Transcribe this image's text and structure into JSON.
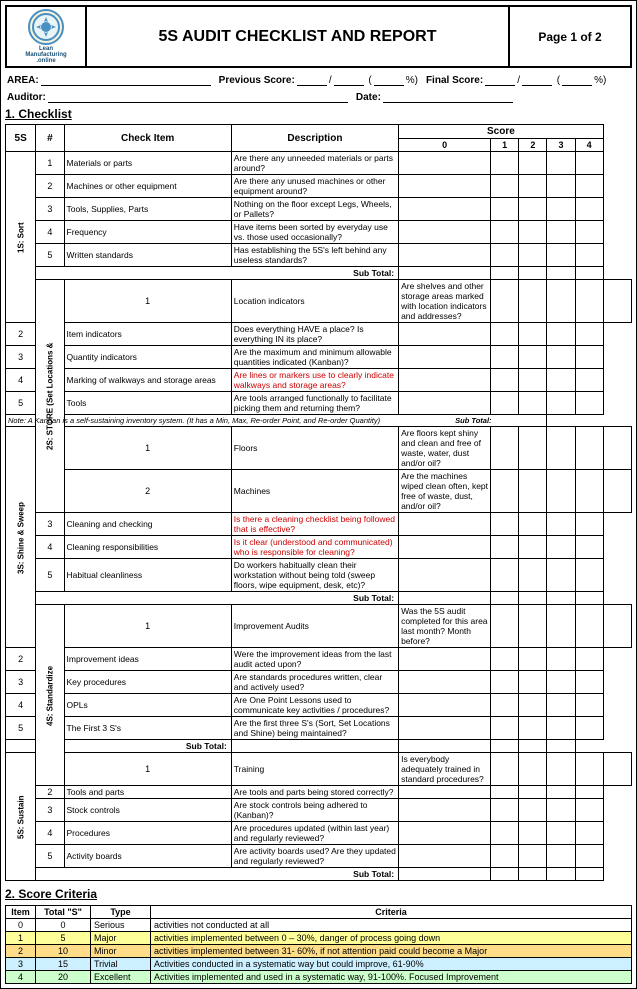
{
  "header": {
    "logo_line1": "Lean",
    "logo_line2": "Manufacturing",
    "logo_line3": ".online",
    "title": "5S AUDIT CHECKLIST AND REPORT",
    "page": "Page 1 of 2"
  },
  "form": {
    "area_label": "AREA:",
    "previous_score_label": "Previous Score:",
    "percent_label": "%",
    "final_score_label": "Final Score:",
    "auditor_label": "Auditor:",
    "date_label": "Date:"
  },
  "section1": {
    "title": "1. Checklist",
    "col_5s": "5S",
    "col_num": "#",
    "col_check": "Check Item",
    "col_desc": "Description",
    "col_score": "Score",
    "score_cols": [
      "0",
      "1",
      "2",
      "3",
      "4"
    ],
    "categories": [
      {
        "name": "1S: Sort",
        "items": [
          {
            "num": "1",
            "check": "Materials or parts",
            "desc": "Are there any unneeded materials or parts around?"
          },
          {
            "num": "2",
            "check": "Machines or other equipment",
            "desc": "Are there any unused machines or other equipment around?"
          },
          {
            "num": "3",
            "check": "Tools, Supplies, Parts",
            "desc": "Nothing on the floor except Legs, Wheels, or Pallets?"
          },
          {
            "num": "4",
            "check": "Frequency",
            "desc": "Have items been sorted by everyday use vs. those used occasionally?"
          },
          {
            "num": "5",
            "check": "Written standards",
            "desc": "Has establishing the 5S's left behind any useless standards?"
          }
        ],
        "subtotal": "Sub Total:"
      },
      {
        "name": "2S: STORE (Set Locations &",
        "items": [
          {
            "num": "1",
            "check": "Location indicators",
            "desc": "Are shelves and other storage areas marked with location indicators and addresses?"
          },
          {
            "num": "2",
            "check": "Item indicators",
            "desc": "Does everything HAVE a place?  Is everything IN its place?"
          },
          {
            "num": "3",
            "check": "Quantity indicators",
            "desc": "Are the maximum and minimum allowable quantities indicated (Kanban)?"
          },
          {
            "num": "4",
            "check": "Marking of walkways and storage areas",
            "desc": "Are lines or markers use to clearly indicate walkways and storage areas?",
            "red": true
          },
          {
            "num": "5",
            "check": "Tools",
            "desc": "Are tools arranged functionally to facilitate picking them and returning them?"
          }
        ],
        "note": "Note: A Kanban is a self-sustaining inventory system. (It has a Min, Max, Re-order Point, and Re-order Quantity)",
        "subtotal": "Sub Total:"
      },
      {
        "name": "3S: Shine & Sweep",
        "items": [
          {
            "num": "1",
            "check": "Floors",
            "desc": "Are floors kept shiny and clean and free of waste, water, dust and/or oil?"
          },
          {
            "num": "2",
            "check": "Machines",
            "desc": "Are the machines wiped clean often, kept free of waste, dust, and/or oil?"
          },
          {
            "num": "3",
            "check": "Cleaning and checking",
            "desc": "Is there a cleaning checklist being followed that is effective?",
            "red": true
          },
          {
            "num": "4",
            "check": "Cleaning responsibilities",
            "desc": "Is it clear (understood and communicated) who is responsible for cleaning?",
            "red": true
          },
          {
            "num": "5",
            "check": "Habitual cleanliness",
            "desc": "Do workers habitually clean their workstation without being told (sweep floors, wipe equipment, desk, etc)?"
          }
        ],
        "subtotal": "Sub Total:"
      },
      {
        "name": "4S: Standardize",
        "items": [
          {
            "num": "1",
            "check": "Improvement Audits",
            "desc": "Was the 5S audit completed for this area last month? Month before?"
          },
          {
            "num": "2",
            "check": "Improvement ideas",
            "desc": "Were the improvement ideas from the last audit acted upon?"
          },
          {
            "num": "3",
            "check": "Key procedures",
            "desc": "Are standards procedures written, clear and actively used?"
          },
          {
            "num": "4",
            "check": "OPLs",
            "desc": "Are One Point Lessons used to communicate key activities / procedures?"
          },
          {
            "num": "5",
            "check": "The First 3 S's",
            "desc": "Are the first three S's (Sort, Set Locations and Shine) being maintained?"
          }
        ],
        "subtotal": "Sub Total:"
      },
      {
        "name": "5S: Sustain",
        "items": [
          {
            "num": "1",
            "check": "Training",
            "desc": "Is everybody adequately trained in standard procedures?"
          },
          {
            "num": "2",
            "check": "Tools and parts",
            "desc": "Are tools and parts being stored correctly?"
          },
          {
            "num": "3",
            "check": "Stock controls",
            "desc": "Are stock controls being adhered to (Kanban)?"
          },
          {
            "num": "4",
            "check": "Procedures",
            "desc": "Are procedures updated (within last year) and regularly reviewed?"
          },
          {
            "num": "5",
            "check": "Activity boards",
            "desc": "Are activity boards used?  Are they updated and regularly reviewed?"
          }
        ],
        "subtotal": "Sub Total:"
      }
    ]
  },
  "section2": {
    "title": "2. Score Criteria",
    "col_item": "Item",
    "col_total": "Total \"S\"",
    "col_type": "Type",
    "col_criteria": "Criteria",
    "rows": [
      {
        "item": "0",
        "total": "0",
        "type": "Serious",
        "criteria": "activities not conducted at all",
        "color": "white"
      },
      {
        "item": "1",
        "total": "5",
        "type": "Major",
        "criteria": "activities implemented between 0 – 30%, danger of process going down",
        "color": "yellow"
      },
      {
        "item": "2",
        "total": "10",
        "type": "Minor",
        "criteria": "activities implemented between 31- 60%, if not attention paid could become a Major",
        "color": "orange"
      },
      {
        "item": "3",
        "total": "15",
        "type": "Trivial",
        "criteria": "Activities conducted in a systematic way but could improve, 61-90%",
        "color": "lightblue"
      },
      {
        "item": "4",
        "total": "20",
        "type": "Excellent",
        "criteria": "Activities implemented and used in a systematic way, 91-100%. Focused Improvement",
        "color": "lightgreen"
      }
    ]
  }
}
